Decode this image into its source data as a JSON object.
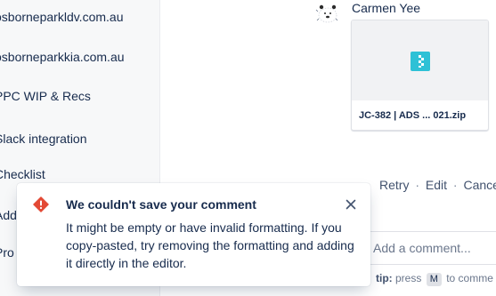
{
  "sidebar": {
    "items": [
      {
        "label": "osborneparkldv.com.au"
      },
      {
        "label": "osborneparkkia.com.au"
      },
      {
        "label": "PPC WIP & Recs"
      },
      {
        "label": "Slack integration"
      },
      {
        "label": "Checklist"
      },
      {
        "label": "Add"
      },
      {
        "label": "Pro"
      }
    ]
  },
  "comment": {
    "author": "Carmen Yee",
    "attachment": {
      "name": "JC-382 | ADS ...  021.zip",
      "icon": "zip-file-icon",
      "icon_color": "#2ec1d6"
    }
  },
  "actions": {
    "retry": "Retry",
    "edit": "Edit",
    "cancel": "Cance",
    "separator": "·"
  },
  "composer": {
    "placeholder": "Add a comment...",
    "tip_label": "tip:",
    "tip_before": "press",
    "tip_key": "M",
    "tip_after": "to comme"
  },
  "error_flag": {
    "title": "We couldn't save your comment",
    "body": "It might be empty or have invalid formatting. If you copy-pasted, try removing the formatting and adding it directly in the editor.",
    "icon": "error-icon",
    "icon_color": "#e34935",
    "close": "close-icon"
  }
}
